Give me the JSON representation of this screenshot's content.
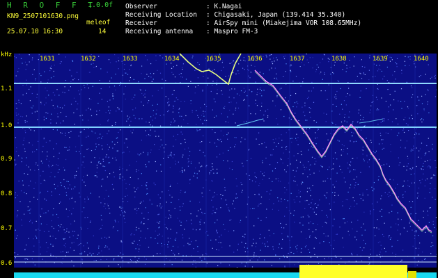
{
  "header": {
    "brand": "H R O F F T",
    "version": "1.0.0f",
    "filename": "KN9_2507101630.png",
    "datetime": "25.07.10 16:30",
    "meleof_label": "meleof",
    "meleof_value": "14",
    "fields": [
      {
        "key": "Observer",
        "value": ": K.Nagai"
      },
      {
        "key": "Receiving Location",
        "value": ": Chigasaki, Japan (139.414 35.340)"
      },
      {
        "key": "Receiver",
        "value": ": AirSpy mini (Miakejima VOR 108.65MHz)"
      },
      {
        "key": "Receiving antenna",
        "value": ": Maspro FM-3"
      }
    ]
  },
  "axes": {
    "y_unit": "kHz",
    "y_ticks": [
      "1.1",
      "1.0",
      "0.9",
      "0.8",
      "0.7",
      "0.6"
    ],
    "x_ticks": [
      "1631",
      "1632",
      "1633",
      "1634",
      "1635",
      "1636",
      "1637",
      "1638",
      "1639",
      "1640"
    ]
  },
  "colors": {
    "background": "#0b0f84",
    "text": "#ffff3a",
    "brand": "#39d039",
    "carrier": "#5fd8ff"
  }
}
